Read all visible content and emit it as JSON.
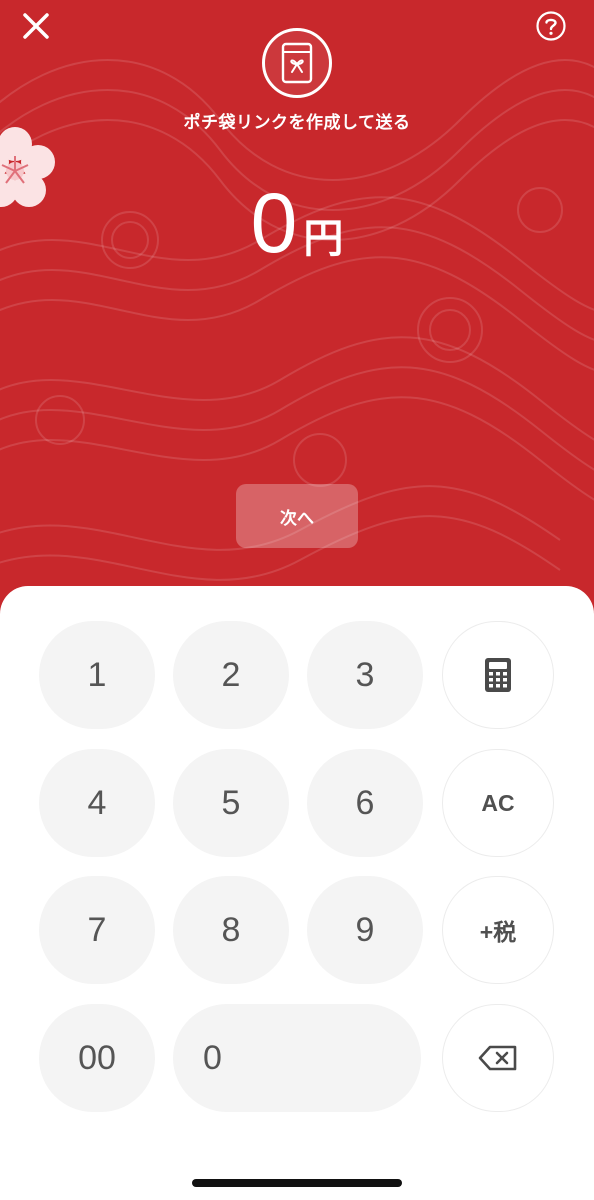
{
  "header": {
    "title": "ポチ袋リンクを作成して送る",
    "close_icon": "close-icon",
    "help_icon": "help-icon"
  },
  "amount": {
    "value": "0",
    "unit": "円"
  },
  "next_button": {
    "label": "次へ"
  },
  "keypad": {
    "keys": [
      "1",
      "2",
      "3",
      "4",
      "5",
      "6",
      "7",
      "8",
      "9",
      "00",
      "0"
    ],
    "ac_label": "AC",
    "tax_label": "+税",
    "calculator_icon": "calculator-icon",
    "backspace_icon": "backspace-icon"
  },
  "colors": {
    "background_red": "#c8282c",
    "key_bg": "#f4f4f4",
    "key_text": "#555555"
  }
}
